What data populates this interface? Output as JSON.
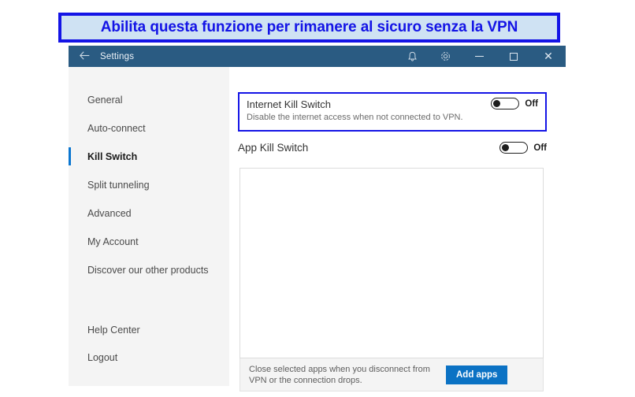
{
  "banner": {
    "text": "Abilita questa funzione per rimanere al sicuro senza la VPN",
    "border_color": "#1414e6",
    "fill_color": "#cfe2f3",
    "text_color": "#1414e6"
  },
  "window": {
    "title": "Settings",
    "back_icon": "back-arrow-icon",
    "titlebar_color": "#2a5b82",
    "titlebar_icons": [
      "bell-icon",
      "gear-icon"
    ],
    "window_controls": {
      "minimize": "–",
      "maximize": "□",
      "close": "✕"
    }
  },
  "sidebar": {
    "items": [
      {
        "label": "General",
        "selected": false
      },
      {
        "label": "Auto-connect",
        "selected": false
      },
      {
        "label": "Kill Switch",
        "selected": true
      },
      {
        "label": "Split tunneling",
        "selected": false
      },
      {
        "label": "Advanced",
        "selected": false
      },
      {
        "label": "My Account",
        "selected": false
      },
      {
        "label": "Discover our other products",
        "selected": false
      }
    ],
    "bottom_items": [
      {
        "label": "Help Center"
      },
      {
        "label": "Logout"
      }
    ],
    "selected_indicator_color": "#0b76d0"
  },
  "main": {
    "internet_kill_switch": {
      "title": "Internet Kill Switch",
      "description": "Disable the internet access when not connected to VPN.",
      "toggle_state": "Off",
      "highlighted": true,
      "highlight_color": "#1414e6"
    },
    "app_kill_switch": {
      "title": "App Kill Switch",
      "toggle_state": "Off"
    },
    "apps_list": {
      "items": []
    },
    "apps_footer": {
      "text": "Close selected apps when you disconnect from VPN or the connection drops.",
      "button_label": "Add apps",
      "button_color": "#0b72c4"
    }
  }
}
